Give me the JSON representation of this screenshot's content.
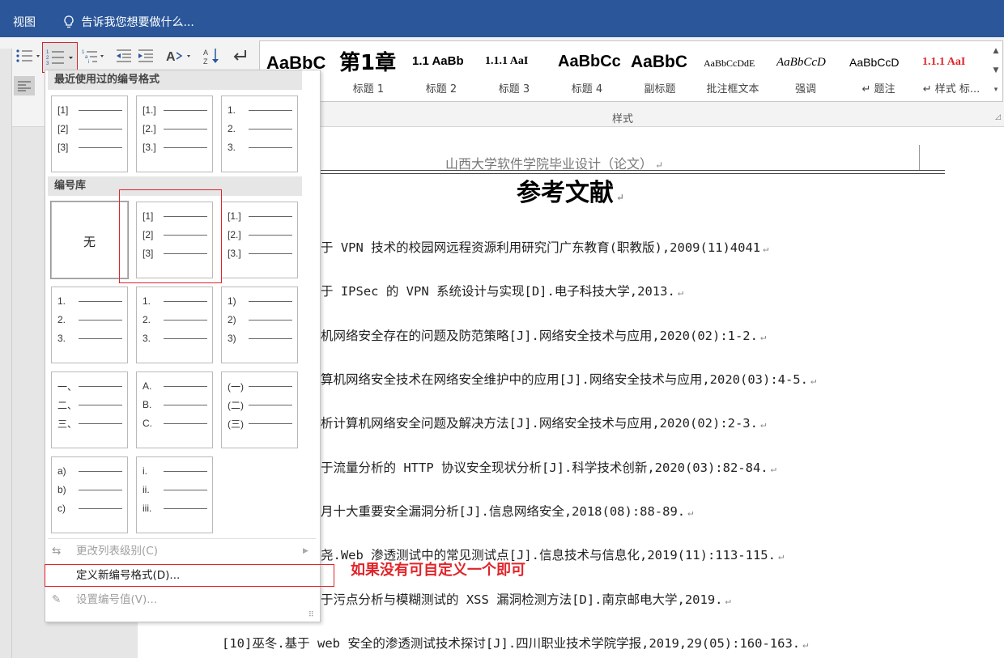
{
  "titlebar": {
    "view_tab": "视图",
    "tell_me": "告诉我您想要做什么..."
  },
  "styles_gallery": {
    "label": "样式",
    "items": [
      {
        "preview": "AaBbC",
        "name": "",
        "preview_style": "bigbold"
      },
      {
        "preview": "第1章",
        "name": "标题 1",
        "preview_style": "h1"
      },
      {
        "preview": "1.1  AaBb",
        "name": "标题 2",
        "preview_style": "h2"
      },
      {
        "preview": "1.1.1  AaI",
        "name": "标题 3",
        "preview_style": "h3"
      },
      {
        "preview": "AaBbCc",
        "name": "标题 4",
        "preview_style": "bigbold"
      },
      {
        "preview": "AaBbC",
        "name": "副标题",
        "preview_style": "bigbold"
      },
      {
        "preview": "AaBbCcDdE",
        "name": "批注框文本",
        "preview_style": "small"
      },
      {
        "preview": "AaBbCcD",
        "name": "强调",
        "preview_style": "italic"
      },
      {
        "preview": "AaBbCcD",
        "name": "↵ 题注",
        "preview_style": "normal"
      },
      {
        "preview": "1.1.1 AaI",
        "name": "↵ 样式 标...",
        "preview_style": "red"
      }
    ],
    "accent": "#2b579a"
  },
  "document": {
    "header": "山西大学软件学院毕业设计（论文）",
    "title": "参考文献",
    "references": [
      "于 VPN 技术的校园网远程资源利用研究门广东教育(职教版),2009(11)4041",
      "于 IPSec 的 VPN 系统设计与实现[D].电子科技大学,2013.",
      "机网络安全存在的问题及防范策略[J].网络安全技术与应用,2020(02):1-2.",
      "算机网络安全技术在网络安全维护中的应用[J].网络安全技术与应用,2020(03):4-5.",
      "析计算机网络安全问题及解决方法[J].网络安全技术与应用,2020(02):2-3.",
      "于流量分析的 HTTP 协议安全现状分析[J].科学技术创新,2020(03):82-84.",
      "月十大重要安全漏洞分析[J].信息网络安全,2018(08):88-89.",
      "尧.Web 渗透测试中的常见测试点[J].信息技术与信息化,2019(11):113-115.",
      "于污点分析与模糊测试的 XSS 漏洞检测方法[D].南京邮电大学,2019.",
      "[10]巫冬.基于 web 安全的渗透测试技术探讨[J].四川职业技术学院学报,2019,29(05):160-163."
    ]
  },
  "numbering_menu": {
    "recent_heading": "最近使用过的编号格式",
    "library_heading": "编号库",
    "none_label": "无",
    "recent": [
      [
        "[1]",
        "[2]",
        "[3]"
      ],
      [
        "[1.]",
        "[2.]",
        "[3.]"
      ],
      [
        "1.",
        "2.",
        "3."
      ]
    ],
    "library": [
      [
        "[1]",
        "[2]",
        "[3]"
      ],
      [
        "[1.]",
        "[2.]",
        "[3.]"
      ],
      [
        "1.",
        "2.",
        "3."
      ],
      [
        "1.",
        "2.",
        "3."
      ],
      [
        "1)",
        "2)",
        "3)"
      ],
      [
        "一、",
        "二、",
        "三、"
      ],
      [
        "A.",
        "B.",
        "C."
      ],
      [
        "(一)",
        "(二)",
        "(三)"
      ],
      [
        "a)",
        "b)",
        "c)"
      ],
      [
        "i.",
        "ii.",
        "iii."
      ]
    ],
    "change_level": "更改列表级别(C)",
    "define_new": "定义新编号格式(D)...",
    "set_value": "设置编号值(V)..."
  },
  "annotation": "如果没有可自定义一个即可"
}
